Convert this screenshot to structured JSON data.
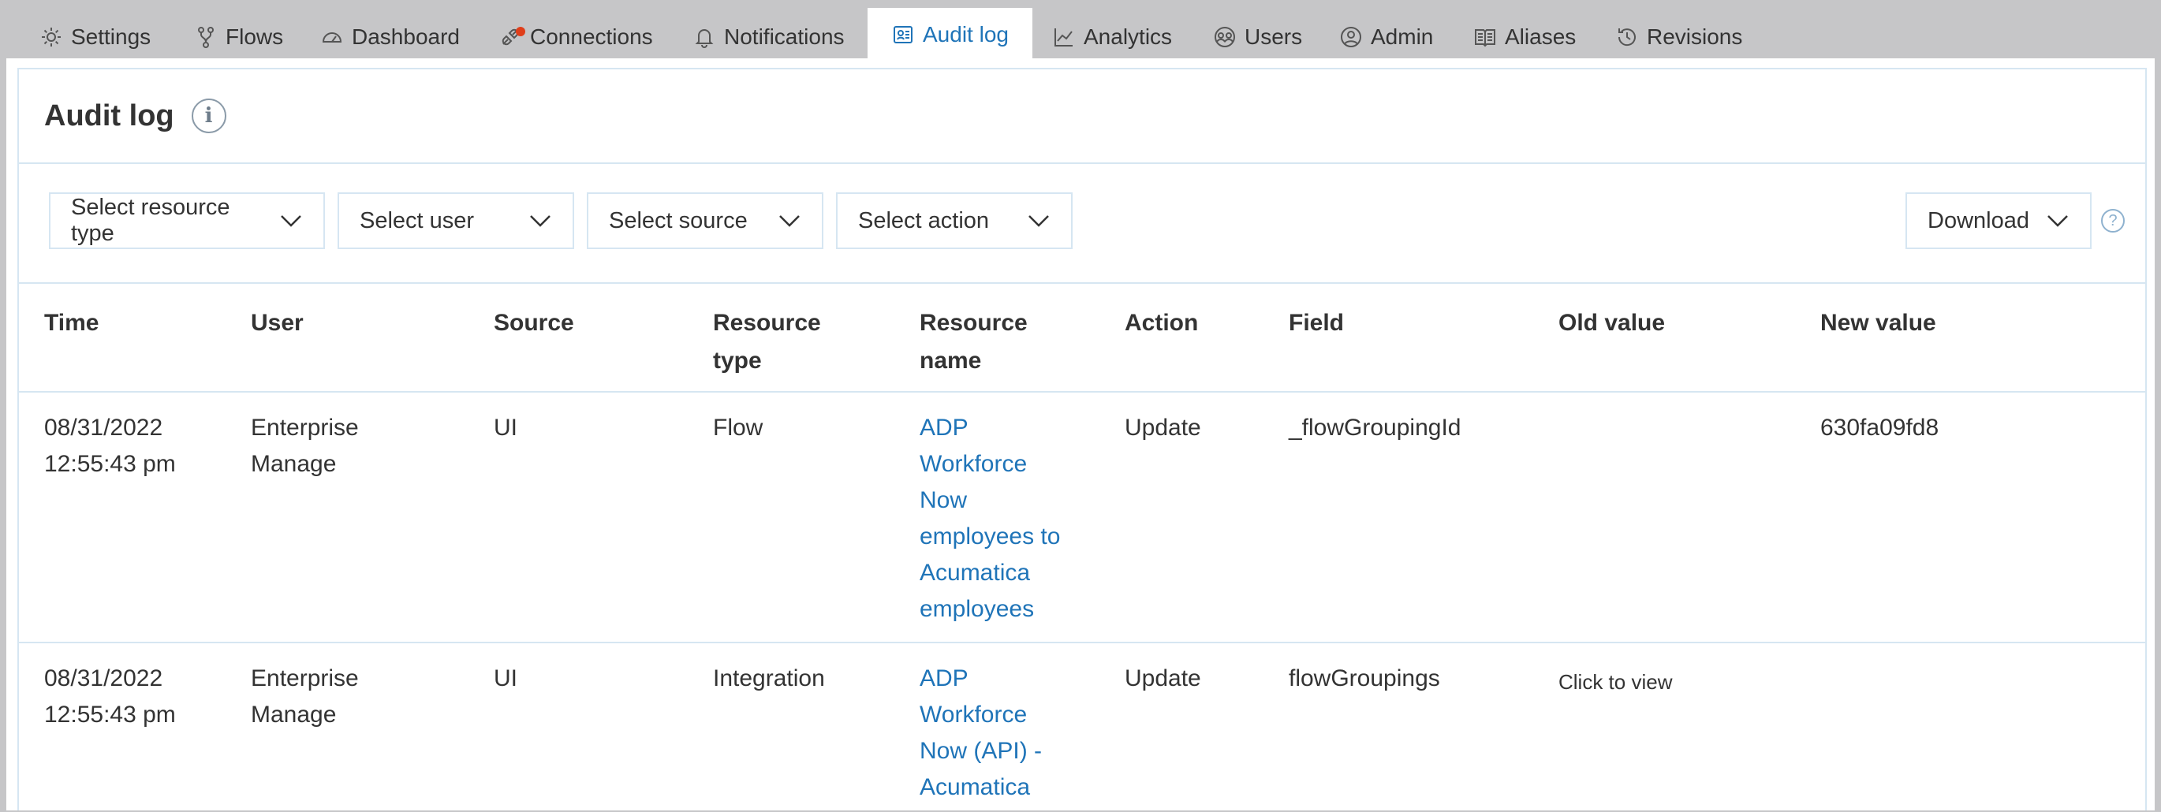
{
  "tabs": [
    {
      "label": "Settings",
      "icon": "gear-icon"
    },
    {
      "label": "Flows",
      "icon": "flows-icon"
    },
    {
      "label": "Dashboard",
      "icon": "dashboard-icon"
    },
    {
      "label": "Connections",
      "icon": "connections-icon"
    },
    {
      "label": "Notifications",
      "icon": "bell-icon"
    },
    {
      "label": "Audit log",
      "icon": "audit-log-icon",
      "active": true
    },
    {
      "label": "Analytics",
      "icon": "analytics-icon"
    },
    {
      "label": "Users",
      "icon": "users-icon"
    },
    {
      "label": "Admin",
      "icon": "admin-icon"
    },
    {
      "label": "Aliases",
      "icon": "aliases-icon"
    },
    {
      "label": "Revisions",
      "icon": "revisions-icon"
    }
  ],
  "colors": {
    "accent": "#1f74b8",
    "border": "#d6e6f2",
    "notification_dot": "#e03e1a"
  },
  "page": {
    "title": "Audit log"
  },
  "filters": {
    "resource_type": "Select resource type",
    "user": "Select user",
    "source": "Select source",
    "action": "Select action",
    "download": "Download",
    "help": "?"
  },
  "table": {
    "headers": {
      "time": "Time",
      "user": "User",
      "source": "Source",
      "resource_type": "Resource type",
      "resource_name": "Resource name",
      "action": "Action",
      "field": "Field",
      "old_value": "Old value",
      "new_value": "New value"
    },
    "rows": [
      {
        "time": "08/31/2022 12:55:43 pm",
        "user": "Enterprise Manage",
        "source": "UI",
        "resource_type": "Flow",
        "resource_name": "ADP Workforce Now employees to Acumatica employees",
        "action": "Update",
        "field": "_flowGroupingId",
        "old_value": "",
        "new_value": "630fa09fd8"
      },
      {
        "time": "08/31/2022 12:55:43 pm",
        "user": "Enterprise Manage",
        "source": "UI",
        "resource_type": "Integration",
        "resource_name": "ADP Workforce Now (API) - Acumatica",
        "action": "Update",
        "field": "flowGroupings",
        "old_value": "Click to view",
        "new_value": ""
      }
    ]
  }
}
